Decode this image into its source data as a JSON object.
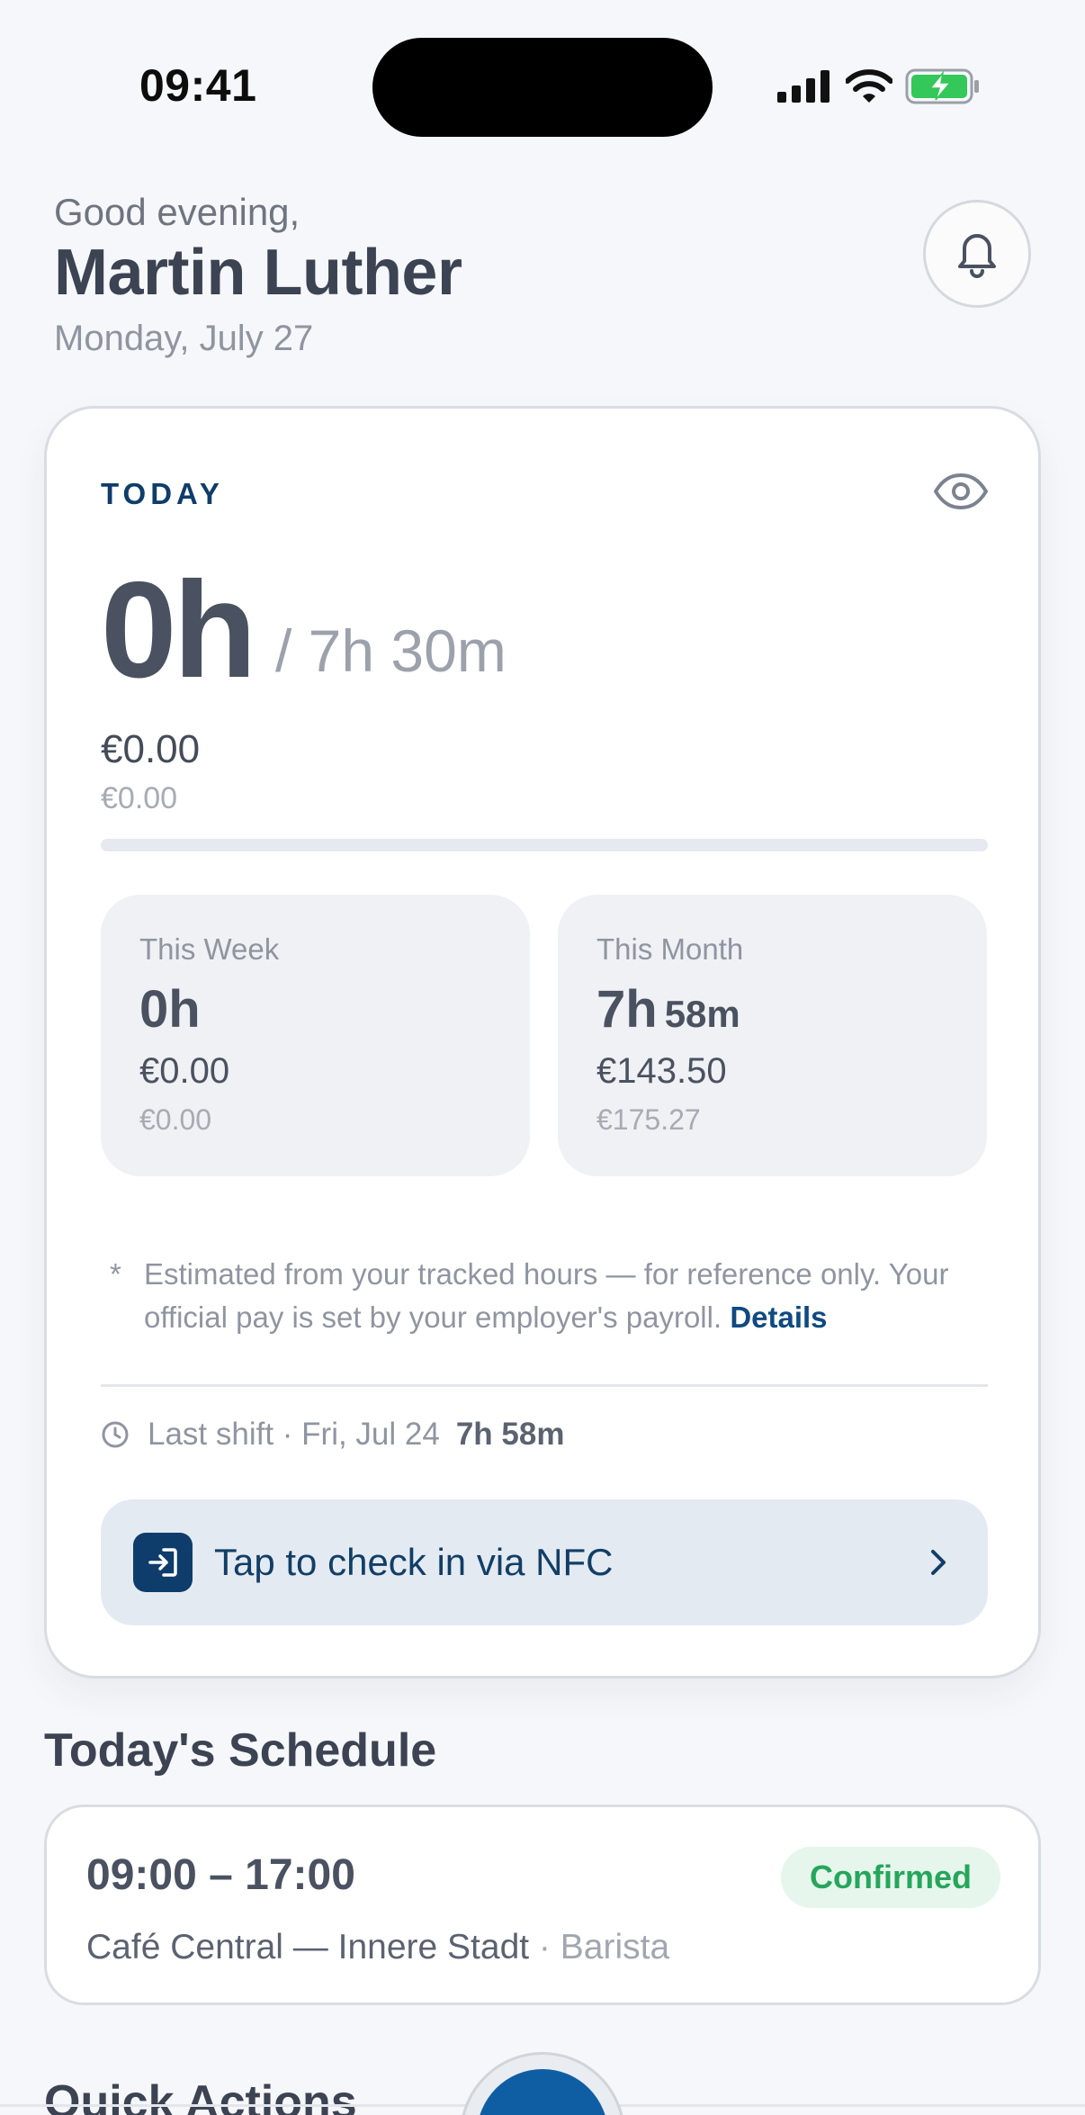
{
  "status_bar": {
    "time": "09:41"
  },
  "header": {
    "greeting": "Good evening,",
    "name": "Martin Luther",
    "date": "Monday, July 27"
  },
  "today": {
    "label": "TODAY",
    "hours": "0h",
    "target": "/ 7h 30m",
    "pay": "€0.00",
    "pay_sub": "€0.00",
    "progress_fraction": 0
  },
  "week": {
    "label": "This Week",
    "hours": "0h",
    "pay": "€0.00",
    "pay_sub": "€0.00"
  },
  "month": {
    "label": "This Month",
    "hours": "7h",
    "minutes": "58m",
    "pay": "€143.50",
    "pay_sub": "€175.27"
  },
  "disclaimer": {
    "star": "*",
    "text": "Estimated from your tracked hours — for reference only. Your official pay is set by your employer's payroll. ",
    "link": "Details"
  },
  "last_shift": {
    "text": "Last shift · Fri, Jul 24",
    "duration": "7h 58m"
  },
  "nfc": {
    "label": "Tap to check in via NFC"
  },
  "schedule": {
    "title": "Today's Schedule",
    "time": "09:00 – 17:00",
    "status": "Confirmed",
    "location": "Café Central — Innere Stadt",
    "role_separator": " · ",
    "role": "Barista"
  },
  "quick_actions": {
    "title": "Quick Actions"
  },
  "colors": {
    "accent": "#0f3d6b",
    "accent_bright": "#0f5ea3",
    "success": "#26a65b",
    "background": "#f6f7fa"
  },
  "icons": [
    "signal-icon",
    "wifi-icon",
    "battery-charging-icon",
    "bell-icon",
    "eye-icon",
    "clock-icon",
    "check-in-icon",
    "chevron-right-icon"
  ]
}
